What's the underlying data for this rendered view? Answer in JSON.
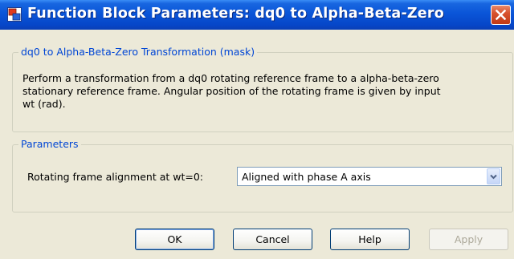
{
  "window": {
    "title": "Function Block Parameters: dq0 to Alpha-Beta-Zero"
  },
  "mask_group": {
    "legend": "dq0 to Alpha-Beta-Zero Transformation (mask)",
    "description_lines": [
      "Perform a transformation from a dq0 rotating reference frame to a alpha-beta-zero",
      "stationary reference frame. Angular position of the rotating frame is given by input",
      "wt (rad)."
    ]
  },
  "parameters_group": {
    "legend": "Parameters",
    "alignment_label": "Rotating frame alignment at wt=0:",
    "alignment_value": "Aligned with phase A axis"
  },
  "buttons": {
    "ok": "OK",
    "cancel": "Cancel",
    "help": "Help",
    "apply": "Apply"
  },
  "icons": {
    "app": "simulink-block-icon",
    "close": "close-icon",
    "dropdown": "chevron-down-icon"
  },
  "colors": {
    "titlebar": "#0a55d8",
    "legend_text": "#0046d5",
    "close_button": "#d8532e",
    "dialog_bg": "#ece9d8"
  }
}
